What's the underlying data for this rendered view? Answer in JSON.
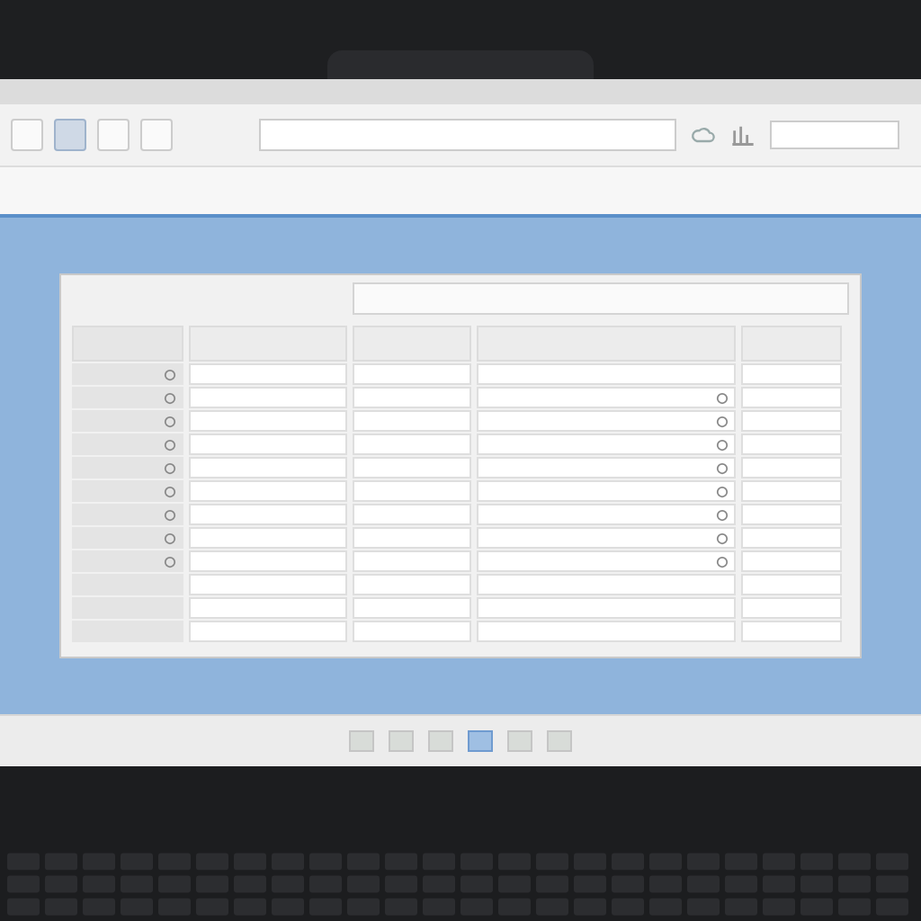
{
  "toolbar": {
    "buttons": [
      {
        "selected": false
      },
      {
        "selected": true
      },
      {
        "selected": false
      },
      {
        "selected": false
      }
    ]
  },
  "table": {
    "rows": [
      {
        "label_icon": true,
        "value_icon": false
      },
      {
        "label_icon": true,
        "value_icon": true
      },
      {
        "label_icon": true,
        "value_icon": true
      },
      {
        "label_icon": true,
        "value_icon": true
      },
      {
        "label_icon": true,
        "value_icon": true
      },
      {
        "label_icon": true,
        "value_icon": true
      },
      {
        "label_icon": true,
        "value_icon": true
      },
      {
        "label_icon": true,
        "value_icon": true
      },
      {
        "label_icon": true,
        "value_icon": true
      },
      {
        "label_icon": false,
        "value_icon": false
      },
      {
        "label_icon": false,
        "value_icon": false
      },
      {
        "label_icon": false,
        "value_icon": false
      }
    ]
  },
  "taskbar": {
    "icons": [
      {
        "selected": false
      },
      {
        "selected": false
      },
      {
        "selected": false
      },
      {
        "selected": true
      },
      {
        "selected": false
      },
      {
        "selected": false
      }
    ]
  }
}
